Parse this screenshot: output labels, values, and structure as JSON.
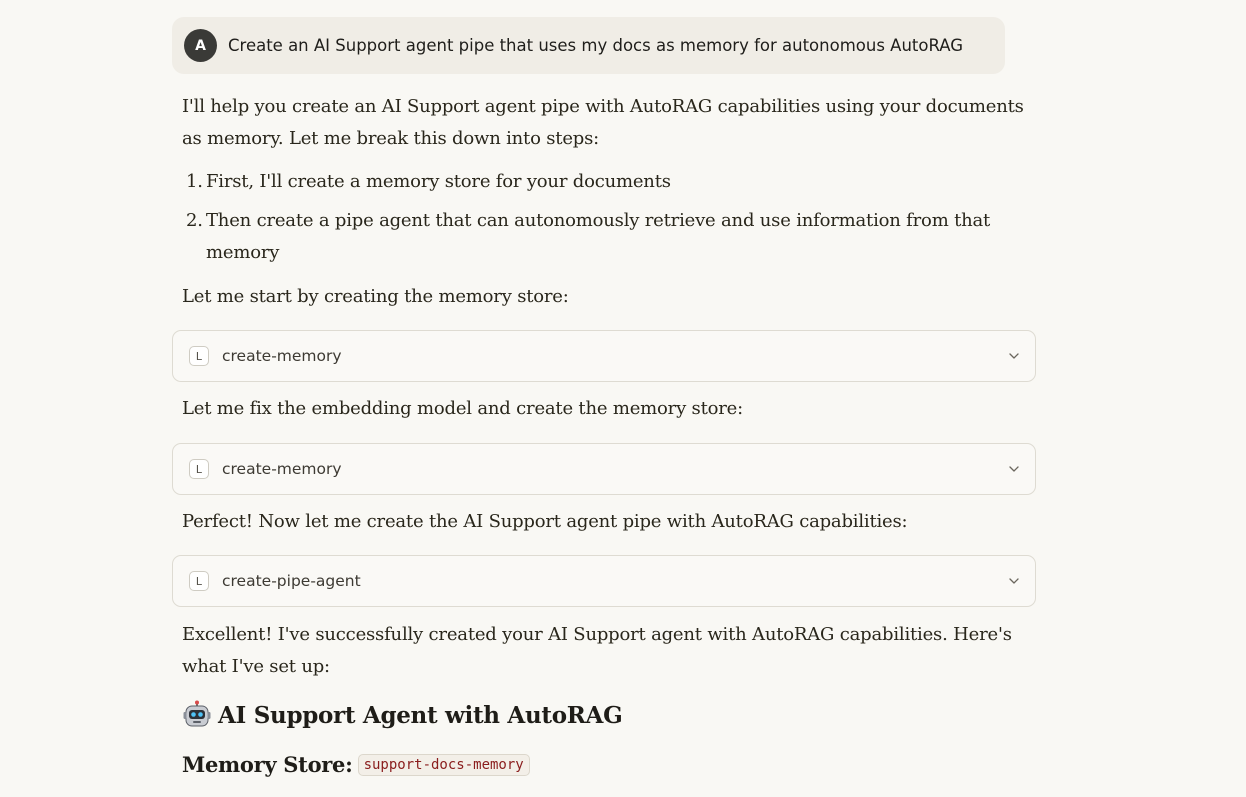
{
  "user_message": {
    "avatar_letter": "A",
    "text": "Create an AI Support agent pipe that uses my docs as memory for autonomous AutoRAG"
  },
  "assistant": {
    "intro_line1": "I'll help you create an AI Support agent pipe with AutoRAG capabilities using your documents",
    "intro_line2": "as memory. Let me break this down into steps:",
    "steps": [
      {
        "number": "1.",
        "line1": "First, I'll create a memory store for your documents",
        "line2": ""
      },
      {
        "number": "2.",
        "line1": "Then create a pipe agent that can autonomously retrieve and use information from that",
        "line2": "memory"
      }
    ],
    "start_text": "Let me start by creating the memory store:",
    "tool_calls": [
      {
        "icon_letter": "L",
        "label": "create-memory",
        "icon": "chevron-down-icon"
      },
      {
        "icon_letter": "L",
        "label": "create-memory",
        "icon": "chevron-down-icon"
      },
      {
        "icon_letter": "L",
        "label": "create-pipe-agent",
        "icon": "chevron-down-icon"
      }
    ],
    "fix_text": "Let me fix the embedding model and create the memory store:",
    "perfect_text": "Perfect! Now let me create the AI Support agent pipe with AutoRAG capabilities:",
    "excellent_line1": "Excellent! I've successfully created your AI Support agent with AutoRAG capabilities. Here's",
    "excellent_line2": "what I've set up:",
    "heading_icon": "robot-icon",
    "heading": "AI Support Agent with AutoRAG",
    "memory_store_label": "Memory Store:",
    "memory_store_value": "support-docs-memory"
  }
}
